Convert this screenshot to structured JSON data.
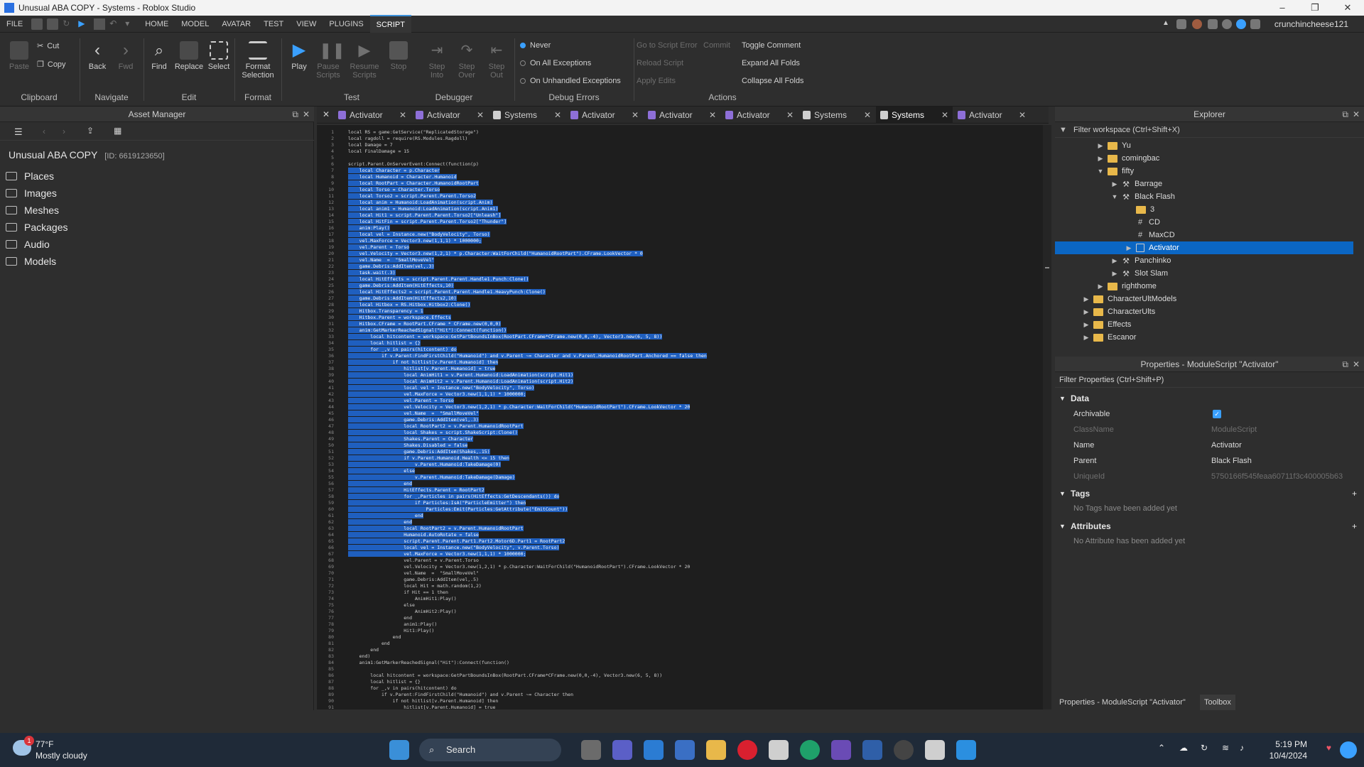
{
  "window": {
    "title": "Unusual ABA COPY - Systems - Roblox Studio",
    "controls": [
      "–",
      "❐",
      "✕"
    ]
  },
  "menu": {
    "items": [
      "FILE",
      "HOME",
      "MODEL",
      "AVATAR",
      "TEST",
      "VIEW",
      "PLUGINS",
      "SCRIPT"
    ],
    "active": "SCRIPT",
    "user": "crunchincheese121"
  },
  "ribbon": {
    "clipboard": {
      "label": "Clipboard",
      "paste": "Paste",
      "cut": "Cut",
      "copy": "Copy"
    },
    "navigate": {
      "label": "Navigate",
      "back": "Back",
      "fwd": "Fwd"
    },
    "edit": {
      "label": "Edit",
      "find": "Find",
      "replace": "Replace",
      "select": "Select"
    },
    "format": {
      "label": "Format",
      "format_selection": "Format Selection"
    },
    "test": {
      "label": "Test",
      "play": "Play",
      "pause": "Pause Scripts",
      "resume": "Resume Scripts",
      "stop": "Stop",
      "step_into": "Step Into",
      "step_over": "Step Over",
      "step_out": "Step Out"
    },
    "debug_errors": {
      "label": "Debug Errors",
      "options": [
        "Never",
        "On All Exceptions",
        "On Unhandled Exceptions"
      ],
      "selected": "Never"
    },
    "debugger": {
      "label": "Debugger"
    },
    "actions": {
      "label": "Actions",
      "goto": "Go to Script Error",
      "commit": "Commit",
      "reload": "Reload Script",
      "apply": "Apply Edits",
      "toggle_comment": "Toggle Comment",
      "expand": "Expand All Folds",
      "collapse": "Collapse All Folds"
    }
  },
  "asset_manager": {
    "title": "Asset Manager",
    "project": "Unusual ABA COPY",
    "id": "[ID: 6619123650]",
    "items": [
      "Places",
      "Images",
      "Meshes",
      "Packages",
      "Audio",
      "Models"
    ]
  },
  "tabs": [
    {
      "label": "Activator",
      "type": "module"
    },
    {
      "label": "Activator",
      "type": "module"
    },
    {
      "label": "Systems",
      "type": "script"
    },
    {
      "label": "Activator",
      "type": "module"
    },
    {
      "label": "Activator",
      "type": "module"
    },
    {
      "label": "Activator",
      "type": "module"
    },
    {
      "label": "Systems",
      "type": "script"
    },
    {
      "label": "Systems",
      "type": "script",
      "active": true
    },
    {
      "label": "Activator",
      "type": "module"
    }
  ],
  "code": [
    "local RS = game:GetService(\"ReplicatedStorage\")",
    "local ragdoll = require(RS.Modules.Ragdoll)",
    "local Damage = 7",
    "local FinalDamage = 15",
    "",
    "script.Parent.OnServerEvent:Connect(function(p)",
    "    local Character = p.Character",
    "    local Humanoid = Character.Humanoid",
    "    local RootPart = Character.HumanoidRootPart",
    "    local Torso = Character.Torso",
    "    local Torso2 = script.Parent.Parent.Torso2",
    "    local anim = Humanoid:LoadAnimation(script.Anim)",
    "    local anim1 = Humanoid:LoadAnimation(script.Anim1)",
    "    local Hit1 = script.Parent.Parent.Torso2[\"Unleash\"]",
    "    local HitFin = script.Parent.Parent.Torso2[\"Thunder\"]",
    "    anim:Play()",
    "    local vel = Instance.new(\"BodyVelocity\", Torso)",
    "    vel.MaxForce = Vector3.new(1,1,1) * 1000000;",
    "    vel.Parent = Torso",
    "    vel.Velocity = Vector3.new(1,2,1) * p.Character:WaitForChild(\"HumanoidRootPart\").CFrame.LookVector * 0",
    "    vel.Name  =  \"SmallMoveVel\"",
    "    game.Debris:AddItem(vel,.3)",
    "    task.wait(.3)",
    "    local HitEffects = script.Parent.Parent.Handle1.Punch:Clone()",
    "    game.Debris:AddItem(HitEffects,10)",
    "    local HitEffects2 = script.Parent.Parent.Handle1.HeavyPunch:Clone()",
    "    game.Debris:AddItem(HitEffects2,10)",
    "    local Hitbox = RS.Hitbox.Hitbox2:Clone()",
    "    Hitbox.Transparency = 1",
    "    Hitbox.Parent = workspace.Effects",
    "    Hitbox.CFrame = RootPart.CFrame * CFrame.new(0,0,0)",
    "    anim:GetMarkerReachedSignal(\"Hit\"):Connect(function()",
    "        local hitcontent = workspace:GetPartBoundsInBox(RootPart.CFrame*CFrame.new(0,0,-4), Vector3.new(6, 5, 8))",
    "        local hitlist = {}",
    "        for _,v in pairs(hitcontent) do",
    "            if v.Parent:FindFirstChild(\"Humanoid\") and v.Parent ~= Character and v.Parent.HumanoidRootPart.Anchored == false then",
    "                if not hitlist[v.Parent.Humanoid] then",
    "                    hitlist[v.Parent.Humanoid] = true",
    "                    local AnimHit1 = v.Parent.Humanoid:LoadAnimation(script.Hit1)",
    "                    local AnimHit2 = v.Parent.Humanoid:LoadAnimation(script.Hit2)",
    "                    local vel = Instance.new(\"BodyVelocity\", Torso)",
    "                    vel.MaxForce = Vector3.new(1,1,1) * 1000000;",
    "                    vel.Parent = Torso",
    "                    vel.Velocity = Vector3.new(1,2,1) * p.Character:WaitForChild(\"HumanoidRootPart\").CFrame.LookVector * 20",
    "                    vel.Name  =  \"SmallMoveVel\"",
    "                    game.Debris:AddItem(vel,.3)",
    "                    local RootPart2 = v.Parent.HumanoidRootPart",
    "                    local Shakes = script.ShakeScript:Clone()",
    "                    Shakes.Parent = Character",
    "                    Shakes.Disabled = false",
    "                    game.Debris:AddItem(Shakes,.15)",
    "                    if v.Parent.Humanoid.Health <= 15 then",
    "                        v.Parent.Humanoid:TakeDamage(0)",
    "                    else",
    "                        v.Parent.Humanoid:TakeDamage(Damage)",
    "                    end",
    "                    HitEffects.Parent = RootPart2",
    "                    for _,Particles in pairs(HitEffects:GetDescendants()) do",
    "                        if Particles:IsA(\"ParticleEmitter\") then",
    "                            Particles:Emit(Particles:GetAttribute(\"EmitCount\"))",
    "                        end",
    "                    end",
    "                    local RootPart2 = v.Parent.HumanoidRootPart",
    "                    Humanoid.AutoRotate = false",
    "                    script.Parent.Parent.Part1.Part2.Motor6D.Part1 = RootPart2",
    "                    local vel = Instance.new(\"BodyVelocity\", v.Parent.Torso)",
    "                    vel.MaxForce = Vector3.new(1,1,1) * 1000000;",
    "                    vel.Parent = v.Parent.Torso",
    "                    vel.Velocity = Vector3.new(1,2,1) * p.Character:WaitForChild(\"HumanoidRootPart\").CFrame.LookVector * 20",
    "                    vel.Name  =  \"SmallMoveVel\"",
    "                    game.Debris:AddItem(vel,.5)",
    "                    local Hit = math.random(1,2)",
    "                    if Hit == 1 then",
    "                        AnimHit1:Play()",
    "                    else",
    "                        AnimHit2:Play()",
    "                    end",
    "                    anim1:Play()",
    "                    Hit1:Play()",
    "                end",
    "            end",
    "        end",
    "    end)",
    "    anim1:GetMarkerReachedSignal(\"Hit\"):Connect(function()",
    "",
    "        local hitcontent = workspace:GetPartBoundsInBox(RootPart.CFrame*CFrame.new(0,0,-4), Vector3.new(6, 5, 8))",
    "        local hitlist = {}",
    "        for _,v in pairs(hitcontent) do",
    "            if v.Parent:FindFirstChild(\"Humanoid\") and v.Parent ~= Character then",
    "                if not hitlist[v.Parent.Humanoid] then",
    "                    hitlist[v.Parent.Humanoid] = true"
  ],
  "selection": {
    "from_line": 7,
    "to_line": 67
  },
  "explorer": {
    "title": "Explorer",
    "filter": "Filter workspace (Ctrl+Shift+X)",
    "items": [
      {
        "label": "Yu",
        "kind": "folder",
        "depth": 2,
        "arrow": "▶"
      },
      {
        "label": "comingbac",
        "kind": "folder",
        "depth": 2,
        "arrow": "▶"
      },
      {
        "label": "fifty",
        "kind": "folder",
        "depth": 2,
        "arrow": "▼"
      },
      {
        "label": "Barrage",
        "kind": "tool",
        "depth": 3,
        "arrow": "▶"
      },
      {
        "label": "Black Flash",
        "kind": "tool",
        "depth": 3,
        "arrow": "▼"
      },
      {
        "label": "3",
        "kind": "folder",
        "depth": 4,
        "arrow": ""
      },
      {
        "label": "CD",
        "kind": "value",
        "depth": 4,
        "arrow": ""
      },
      {
        "label": "MaxCD",
        "kind": "value",
        "depth": 4,
        "arrow": ""
      },
      {
        "label": "Activator",
        "kind": "module",
        "depth": 4,
        "arrow": "▶",
        "selected": true
      },
      {
        "label": "Panchinko",
        "kind": "tool",
        "depth": 3,
        "arrow": "▶"
      },
      {
        "label": "Slot Slam",
        "kind": "tool",
        "depth": 3,
        "arrow": "▶"
      },
      {
        "label": "righthome",
        "kind": "folder",
        "depth": 2,
        "arrow": "▶"
      },
      {
        "label": "CharacterUltModels",
        "kind": "folder",
        "depth": 1,
        "arrow": "▶"
      },
      {
        "label": "CharacterUlts",
        "kind": "folder",
        "depth": 1,
        "arrow": "▶"
      },
      {
        "label": "Effects",
        "kind": "folder",
        "depth": 1,
        "arrow": "▶"
      },
      {
        "label": "Escanor",
        "kind": "folder",
        "depth": 1,
        "arrow": "▶"
      }
    ]
  },
  "properties": {
    "title": "Properties - ModuleScript \"Activator\"",
    "filter": "Filter Properties (Ctrl+Shift+P)",
    "data_label": "Data",
    "rows": [
      {
        "k": "Archivable",
        "v": "",
        "checkbox": true
      },
      {
        "k": "ClassName",
        "v": "ModuleScript",
        "disabled": true
      },
      {
        "k": "Name",
        "v": "Activator"
      },
      {
        "k": "Parent",
        "v": "Black Flash"
      },
      {
        "k": "UniqueId",
        "v": "5750166f545feaa60711f3c400005b63",
        "disabled": true
      }
    ],
    "tags_label": "Tags",
    "tags_empty": "No Tags have been added yet",
    "attr_label": "Attributes",
    "attr_empty": "No Attribute has been added yet",
    "bottom_tab1": "Properties - ModuleScript \"Activator\"",
    "bottom_tab2": "Toolbox"
  },
  "taskbar": {
    "temp": "77°F",
    "weather": "Mostly cloudy",
    "search": "Search",
    "time": "5:19 PM",
    "date": "10/4/2024",
    "badge": "1"
  },
  "colors": {
    "selection": "#1f5fbf",
    "accent": "#3a8fd8",
    "explorer_select": "#0b66c3",
    "folder": "#e8b84a"
  }
}
